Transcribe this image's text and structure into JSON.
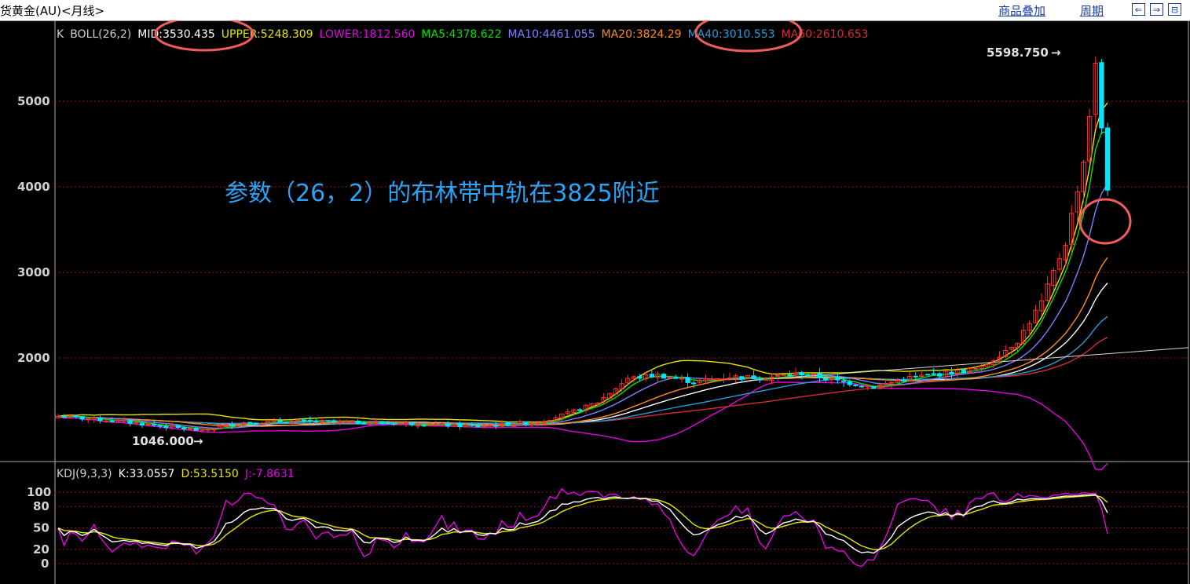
{
  "window": {
    "title": "货黄金(AU)<月线>",
    "overlay_link": "商品叠加",
    "period_link": "周期"
  },
  "colors": {
    "mid": "#ffffff",
    "upper": "#e6e600",
    "lower": "#e600e6",
    "ma5": "#00e000",
    "ma10": "#7f7fff",
    "ma20": "#ff8c1a",
    "ma40": "#2a9bd8",
    "ma60": "#d82a3a",
    "up": "#ff3030",
    "down": "#00e5ff",
    "annotation": "#2ba3f5",
    "circle": "#f25c5c"
  },
  "chart_data": [
    {
      "type": "candlestick",
      "indicator": "BOLL(26,2)",
      "legend": [
        {
          "key": "k",
          "text": "K",
          "color": "#d0d0d0"
        },
        {
          "key": "boll",
          "text": "BOLL(26,2)",
          "color": "#d0d0d0"
        },
        {
          "key": "mid",
          "text": "MID:3530.435",
          "color": "#ffffff"
        },
        {
          "key": "upper",
          "text": "UPPER:5248.309",
          "color": "#e6e600"
        },
        {
          "key": "lower",
          "text": "LOWER:1812.560",
          "color": "#e600e6"
        },
        {
          "key": "ma5",
          "text": "MA5:4378.622",
          "color": "#00e000"
        },
        {
          "key": "ma10",
          "text": "MA10:4461.055",
          "color": "#7f7fff"
        },
        {
          "key": "ma20",
          "text": "MA20:3824.29",
          "color": "#ff8c1a"
        },
        {
          "key": "ma40",
          "text": "MA40:3010.553",
          "color": "#2a9bd8"
        },
        {
          "key": "ma60",
          "text": "MA60:2610.653",
          "color": "#d82a3a"
        }
      ],
      "y_ticks": [
        "5000",
        "4000",
        "3000",
        "2000"
      ],
      "ylim": [
        900,
        5800
      ],
      "max_label": "5598.750",
      "min_label": "1046.000",
      "annotation": "参数（26，2）的布林带中轨在3825附近"
    },
    {
      "type": "line",
      "indicator": "KDJ(9,3,3)",
      "legend": [
        {
          "key": "kdj",
          "text": "KDJ(9,3,3)",
          "color": "#d0d0d0"
        },
        {
          "key": "k",
          "text": "K:33.0557",
          "color": "#ffffff"
        },
        {
          "key": "d",
          "text": "D:53.5150",
          "color": "#e6e600"
        },
        {
          "key": "j",
          "text": "J:-7.8631",
          "color": "#e600e6"
        }
      ],
      "y_ticks": [
        "100",
        "80",
        "50",
        "20",
        "0"
      ],
      "ylim": [
        -10,
        120
      ]
    }
  ]
}
